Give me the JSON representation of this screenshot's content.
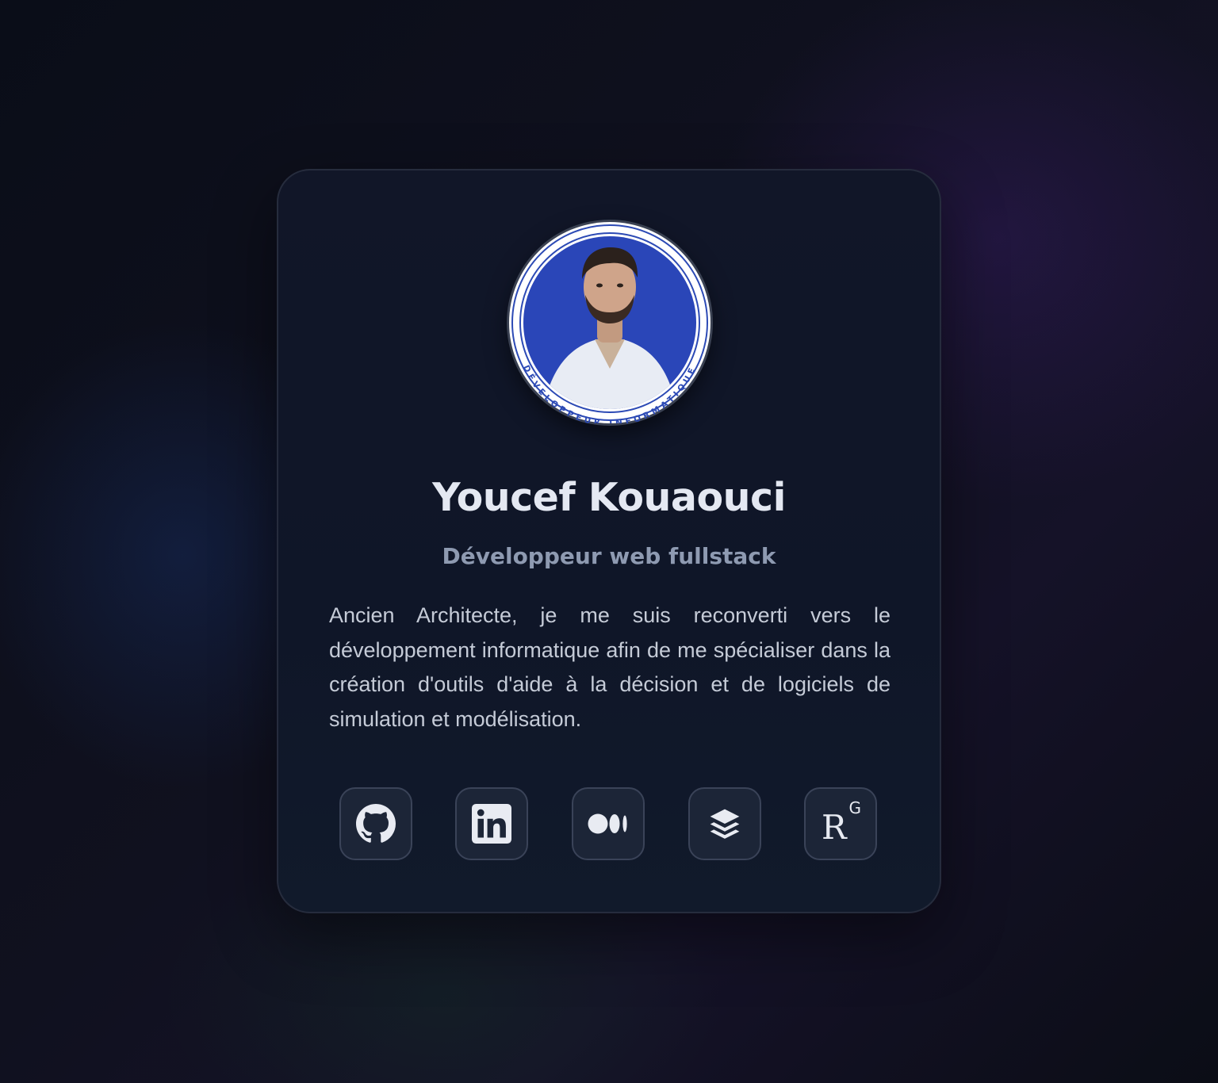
{
  "profile": {
    "name": "Youcef Kouaouci",
    "role": "Développeur web fullstack",
    "bio": "Ancien Architecte, je me suis reconverti vers le développement informatique afin de me spécialiser dans la création d'outils d'aide à la décision et de logiciels de simulation et modélisation.",
    "avatar_ring_text": "DÉVELOPPEUR INFORMATIQUE"
  },
  "socials": [
    {
      "icon": "github-icon"
    },
    {
      "icon": "linkedin-icon"
    },
    {
      "icon": "medium-icon"
    },
    {
      "icon": "stackshare-icon"
    },
    {
      "icon": "researchgate-icon",
      "label_main": "R",
      "label_sup": "G"
    }
  ],
  "colors": {
    "card_bg": "#111628",
    "card_border": "#262c3d",
    "name": "#e4e8f2",
    "role": "#8e9ab1",
    "bio": "#c5cbd7",
    "button_bg": "#1c2537",
    "button_border": "#3a4358",
    "avatar_bg": "#2a46b8"
  }
}
